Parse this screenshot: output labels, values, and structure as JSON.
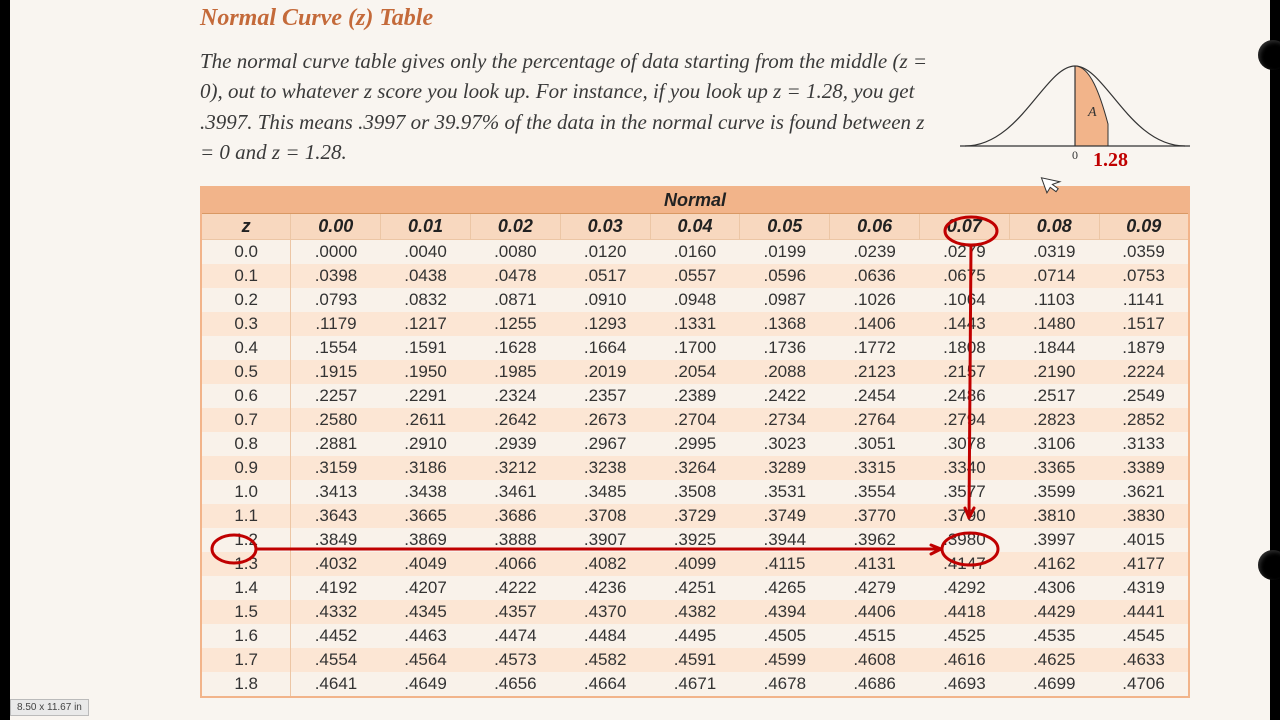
{
  "title": "Normal Curve (z) Table",
  "description_html": "The normal curve table gives only the percentage of data starting from the middle (z = 0), out to whatever z score you look up. For instance, if you look up z = 1.28, you get .3997. This means .3997 or 39.97% of the data in the normal curve is found between z = 0 and z = 1.28.",
  "curve_area_label": "A",
  "curve_ann_zero": "0",
  "curve_ann_z": "1.28",
  "table_header": "Normal",
  "columns": [
    "z",
    "0.00",
    "0.01",
    "0.02",
    "0.03",
    "0.04",
    "0.05",
    "0.06",
    "0.07",
    "0.08",
    "0.09"
  ],
  "rows": [
    {
      "z": "0.0",
      "v": [
        ".0000",
        ".0040",
        ".0080",
        ".0120",
        ".0160",
        ".0199",
        ".0239",
        ".0279",
        ".0319",
        ".0359"
      ]
    },
    {
      "z": "0.1",
      "v": [
        ".0398",
        ".0438",
        ".0478",
        ".0517",
        ".0557",
        ".0596",
        ".0636",
        ".0675",
        ".0714",
        ".0753"
      ]
    },
    {
      "z": "0.2",
      "v": [
        ".0793",
        ".0832",
        ".0871",
        ".0910",
        ".0948",
        ".0987",
        ".1026",
        ".1064",
        ".1103",
        ".1141"
      ]
    },
    {
      "z": "0.3",
      "v": [
        ".1179",
        ".1217",
        ".1255",
        ".1293",
        ".1331",
        ".1368",
        ".1406",
        ".1443",
        ".1480",
        ".1517"
      ]
    },
    {
      "z": "0.4",
      "v": [
        ".1554",
        ".1591",
        ".1628",
        ".1664",
        ".1700",
        ".1736",
        ".1772",
        ".1808",
        ".1844",
        ".1879"
      ]
    },
    {
      "z": "0.5",
      "v": [
        ".1915",
        ".1950",
        ".1985",
        ".2019",
        ".2054",
        ".2088",
        ".2123",
        ".2157",
        ".2190",
        ".2224"
      ]
    },
    {
      "z": "0.6",
      "v": [
        ".2257",
        ".2291",
        ".2324",
        ".2357",
        ".2389",
        ".2422",
        ".2454",
        ".2486",
        ".2517",
        ".2549"
      ]
    },
    {
      "z": "0.7",
      "v": [
        ".2580",
        ".2611",
        ".2642",
        ".2673",
        ".2704",
        ".2734",
        ".2764",
        ".2794",
        ".2823",
        ".2852"
      ]
    },
    {
      "z": "0.8",
      "v": [
        ".2881",
        ".2910",
        ".2939",
        ".2967",
        ".2995",
        ".3023",
        ".3051",
        ".3078",
        ".3106",
        ".3133"
      ]
    },
    {
      "z": "0.9",
      "v": [
        ".3159",
        ".3186",
        ".3212",
        ".3238",
        ".3264",
        ".3289",
        ".3315",
        ".3340",
        ".3365",
        ".3389"
      ]
    },
    {
      "z": "1.0",
      "v": [
        ".3413",
        ".3438",
        ".3461",
        ".3485",
        ".3508",
        ".3531",
        ".3554",
        ".3577",
        ".3599",
        ".3621"
      ]
    },
    {
      "z": "1.1",
      "v": [
        ".3643",
        ".3665",
        ".3686",
        ".3708",
        ".3729",
        ".3749",
        ".3770",
        ".3790",
        ".3810",
        ".3830"
      ]
    },
    {
      "z": "1.2",
      "v": [
        ".3849",
        ".3869",
        ".3888",
        ".3907",
        ".3925",
        ".3944",
        ".3962",
        ".3980",
        ".3997",
        ".4015"
      ]
    },
    {
      "z": "1.3",
      "v": [
        ".4032",
        ".4049",
        ".4066",
        ".4082",
        ".4099",
        ".4115",
        ".4131",
        ".4147",
        ".4162",
        ".4177"
      ]
    },
    {
      "z": "1.4",
      "v": [
        ".4192",
        ".4207",
        ".4222",
        ".4236",
        ".4251",
        ".4265",
        ".4279",
        ".4292",
        ".4306",
        ".4319"
      ]
    },
    {
      "z": "1.5",
      "v": [
        ".4332",
        ".4345",
        ".4357",
        ".4370",
        ".4382",
        ".4394",
        ".4406",
        ".4418",
        ".4429",
        ".4441"
      ]
    },
    {
      "z": "1.6",
      "v": [
        ".4452",
        ".4463",
        ".4474",
        ".4484",
        ".4495",
        ".4505",
        ".4515",
        ".4525",
        ".4535",
        ".4545"
      ]
    },
    {
      "z": "1.7",
      "v": [
        ".4554",
        ".4564",
        ".4573",
        ".4582",
        ".4591",
        ".4599",
        ".4608",
        ".4616",
        ".4625",
        ".4633"
      ]
    },
    {
      "z": "1.8",
      "v": [
        ".4641",
        ".4649",
        ".4656",
        ".4664",
        ".4671",
        ".4678",
        ".4686",
        ".4693",
        ".4699",
        ".4706"
      ]
    }
  ],
  "highlight": {
    "row_z": "1.2",
    "col": "0.08",
    "value": ".3997"
  },
  "page_dim_label": "8.50 x 11.67 in"
}
